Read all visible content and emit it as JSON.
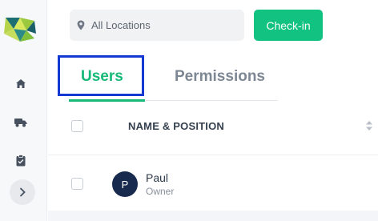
{
  "sidebar": {
    "logo": "app-logo",
    "nav": [
      {
        "icon": "home-icon"
      },
      {
        "icon": "truck-icon"
      },
      {
        "icon": "clipboard-icon"
      }
    ],
    "expand_icon": "chevron-right-icon"
  },
  "header": {
    "location_label": "All Locations",
    "location_icon": "map-pin-icon",
    "checkin_label": "Check-in"
  },
  "tabs": [
    {
      "label": "Users",
      "active": true
    },
    {
      "label": "Permissions",
      "active": false
    }
  ],
  "table": {
    "column_header": "NAME & POSITION",
    "rows": [
      {
        "initial": "P",
        "name": "Paul",
        "position": "Owner"
      }
    ]
  },
  "colors": {
    "accent": "#16b978",
    "button": "#12c280",
    "avatar": "#182a4e",
    "focus_outline": "#1438d4"
  }
}
